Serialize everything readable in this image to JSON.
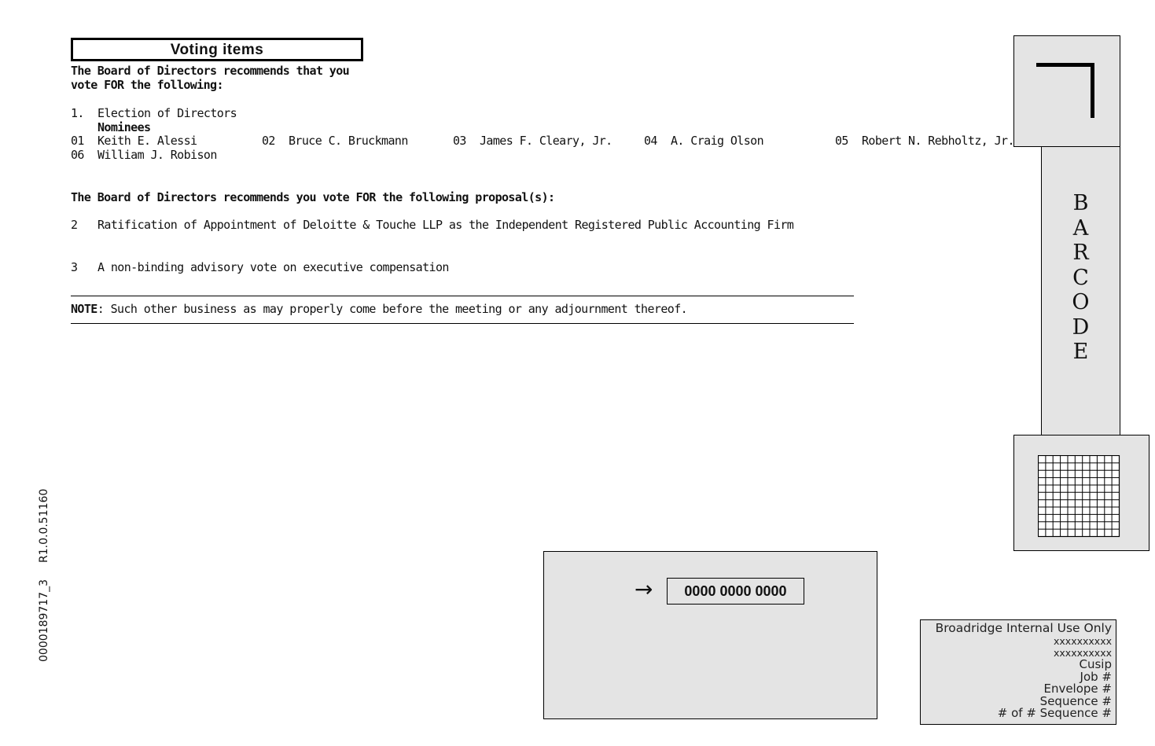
{
  "section_title": "Voting items",
  "intro": {
    "line1": "The Board of Directors recommends that you",
    "line2": "vote FOR the following:"
  },
  "item1": {
    "number": "1.",
    "label": "Election of Directors",
    "nominees_label": "Nominees",
    "nominees": [
      {
        "num": "01",
        "name": "Keith E. Alessi"
      },
      {
        "num": "02",
        "name": "Bruce C. Bruckmann"
      },
      {
        "num": "03",
        "name": "James F. Cleary, Jr."
      },
      {
        "num": "04",
        "name": "A. Craig Olson"
      },
      {
        "num": "05",
        "name": "Robert N. Rebholtz, Jr."
      },
      {
        "num": "06",
        "name": "William J. Robison"
      }
    ]
  },
  "proposals_intro": "The Board of Directors recommends you vote FOR the following proposal(s):",
  "proposals": [
    {
      "num": "2",
      "text": "Ratification of Appointment of Deloitte & Touche LLP as the Independent Registered Public Accounting Firm"
    },
    {
      "num": "3",
      "text": "A non-binding advisory vote on executive compensation"
    }
  ],
  "note": {
    "label": "NOTE",
    "text": ": Such other business as may properly come before the meeting or any adjournment thereof."
  },
  "barcode": {
    "letters": [
      "B",
      "A",
      "R",
      "C",
      "O",
      "D",
      "E"
    ]
  },
  "control": {
    "arrow_icon": "→",
    "number": "0000 0000 0000"
  },
  "internal_use": {
    "title": "Broadridge Internal Use Only",
    "lines": [
      "xxxxxxxxxx",
      "xxxxxxxxxx",
      "Cusip",
      "Job #",
      "Envelope #",
      "Sequence #",
      "# of # Sequence #"
    ]
  },
  "side_codes": {
    "doc_id": "0000189717_3",
    "revision": "R1.0.0.51160"
  },
  "colors": {
    "box_fill": "#e4e4e4",
    "ink": "#000000"
  }
}
